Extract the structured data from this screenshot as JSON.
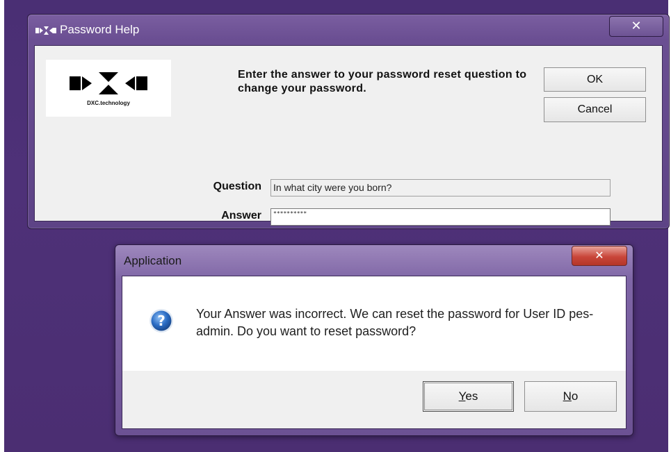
{
  "password_help": {
    "title": "Password Help",
    "close_glyph": "✕",
    "logo_text": "DXC.technology",
    "instructions": "Enter the answer to your password reset question to change your password.",
    "ok_label": "OK",
    "cancel_label": "Cancel",
    "question_label": "Question",
    "question_value": "In what city were you born?",
    "answer_label": "Answer",
    "answer_value": "**********"
  },
  "application_dialog": {
    "title": "Application",
    "close_glyph": "✕",
    "icon": "question-icon",
    "message": "Your Answer was incorrect. We can reset the password for User ID pes-admin.  Do you want to reset password?",
    "yes_mnemonic": "Y",
    "yes_rest": "es",
    "no_mnemonic": "N",
    "no_rest": "o"
  },
  "colors": {
    "desktop": "#4e3178",
    "dialog_bg": "#f0f0f0",
    "close_red": "#c9463a",
    "question_blue": "#2a6cc4"
  }
}
